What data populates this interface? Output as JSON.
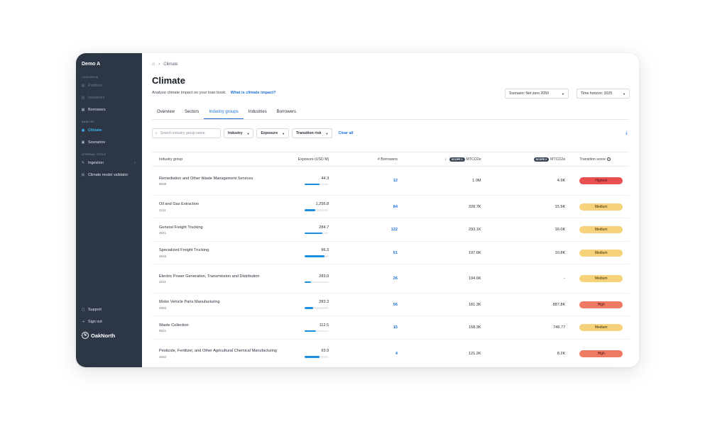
{
  "sidebar": {
    "org": "Demo A",
    "sections": {
      "loan_book": "Loan book",
      "analyse": "Analyse",
      "internal_tools": "Internal tools"
    },
    "items": {
      "portfolio": "Portfolio",
      "industries": "Industries",
      "borrowers": "Borrowers",
      "climate": "Climate",
      "scenarios": "Scenarios",
      "ingestion": "Ingestion",
      "validator": "Climate model validator",
      "support": "Support",
      "sign_out": "Sign out"
    },
    "logo": "OakNorth"
  },
  "breadcrumb": {
    "current": "Climate"
  },
  "page": {
    "title": "Climate",
    "subtitle": "Analyze climate impact on your loan book.",
    "help_link": "What is climate impact?"
  },
  "controls": {
    "scenario": "Scenario: Net zero 2050",
    "time_horizon": "Time horizon: 2025"
  },
  "tabs": [
    "Overview",
    "Sectors",
    "Industry groups",
    "Industries",
    "Borrowers"
  ],
  "filters": {
    "search_placeholder": "Search industry group name",
    "industry": "Industry",
    "exposure": "Exposure",
    "transition_risk": "Transition risk",
    "clear": "Clear all"
  },
  "table": {
    "headers": {
      "industry_group": "Industry group",
      "exposure": "Exposure (USD M)",
      "borrowers": "# Borrowers",
      "scope1_tag": "SCOPE 1",
      "scope1_unit": "MTCO2e",
      "scope2_tag": "SCOPE 2",
      "scope2_unit": "MTCO2e",
      "transition": "Transition score"
    },
    "rows": [
      {
        "name": "Remediation and Other Waste Management Services",
        "code": "5629",
        "exposure": "44.3",
        "fill": 0.62,
        "borrowers": "12",
        "scope1": "1.0M",
        "scope2": "4.9K",
        "score": "Highest"
      },
      {
        "name": "Oil and Gas Extraction",
        "code": "2111",
        "exposure": "1,256.8",
        "fill": 0.42,
        "borrowers": "84",
        "scope1": "328.7K",
        "scope2": "15.9K",
        "score": "Medium"
      },
      {
        "name": "General Freight Trucking",
        "code": "4841",
        "exposure": "284.7",
        "fill": 0.72,
        "borrowers": "122",
        "scope1": "293.1K",
        "scope2": "16.0K",
        "score": "Medium"
      },
      {
        "name": "Specialized Freight Trucking",
        "code": "4842",
        "exposure": "96.3",
        "fill": 0.82,
        "borrowers": "51",
        "scope1": "197.6K",
        "scope2": "10.8K",
        "score": "Medium"
      },
      {
        "name": "Electric Power Generation, Transmission and Distribution",
        "code": "2211",
        "exposure": "283.0",
        "fill": 0.25,
        "borrowers": "26",
        "scope1": "194.6K",
        "scope2": "-",
        "score": "Medium"
      },
      {
        "name": "Motor Vehicle Parts Manufacturing",
        "code": "3363",
        "exposure": "283.3",
        "fill": 0.36,
        "borrowers": "56",
        "scope1": "181.3K",
        "scope2": "887.8K",
        "score": "High"
      },
      {
        "name": "Waste Collection",
        "code": "5621",
        "exposure": "112.5",
        "fill": 0.45,
        "borrowers": "15",
        "scope1": "158.3K",
        "scope2": "746.77",
        "score": "Medium"
      },
      {
        "name": "Pesticide, Fertilizer, and Other Agricultural Chemical Manufacturing",
        "code": "3253",
        "exposure": "93.9",
        "fill": 0.62,
        "borrowers": "4",
        "scope1": "121.2K",
        "scope2": "8.2K",
        "score": "High"
      }
    ]
  },
  "colors": {
    "Highest": "#e94f4f",
    "High": "#ee7a64",
    "Medium": "#f6d27a",
    "accent": "#1b6fd6",
    "sidebar": "#2c3645"
  }
}
